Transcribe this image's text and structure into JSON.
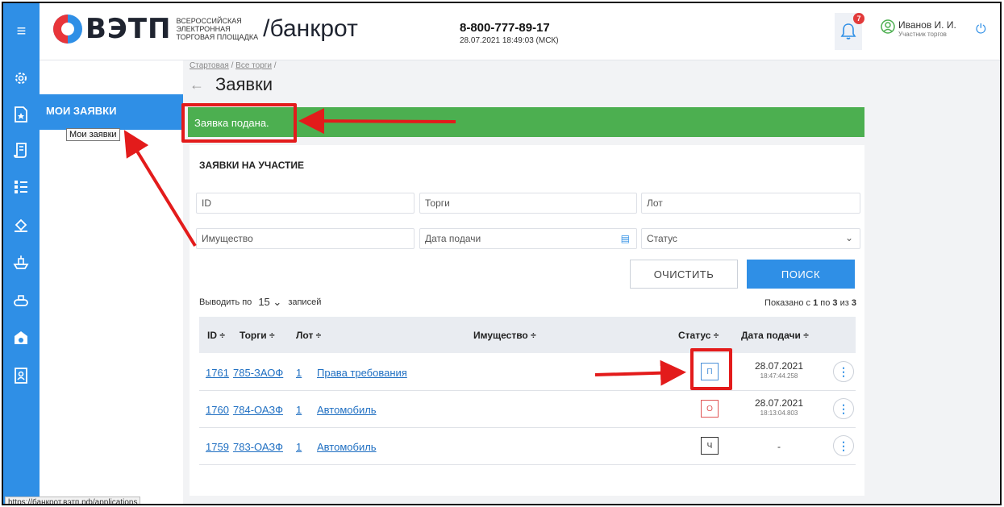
{
  "header": {
    "logo_text": "ВЭТП",
    "logo_sub_line1": "Всероссийская",
    "logo_sub_line2": "электронная",
    "logo_sub_line3": "торговая площадка",
    "logo_suffix": "/банкрот",
    "phone": "8-800-777-89-17",
    "datetime": "28.07.2021 18:49:03 (МСК)",
    "notifications_count": "7",
    "user_name": "Иванов И. И.",
    "user_role": "Участник торгов"
  },
  "subnav": {
    "active_item": "МОИ ЗАЯВКИ",
    "tooltip": "Мои заявки"
  },
  "breadcrumb": {
    "item1": "Стартовая",
    "sep": "/",
    "item2": "Все торги"
  },
  "page": {
    "title": "Заявки"
  },
  "alert": {
    "message": "Заявка подана."
  },
  "form": {
    "title": "ЗАЯВКИ НА УЧАСТИЕ",
    "id_placeholder": "ID",
    "trades_placeholder": "Торги",
    "lot_placeholder": "Лот",
    "property_placeholder": "Имущество",
    "date_placeholder": "Дата подачи",
    "status_placeholder": "Статус",
    "clear_label": "ОЧИСТИТЬ",
    "search_label": "ПОИСК"
  },
  "pagination": {
    "prefix": "Выводить по",
    "per_page": "15",
    "suffix": "записей",
    "shown_prefix": "Показано с",
    "from": "1",
    "to_word": "по",
    "to": "3",
    "of_word": "из",
    "total": "3"
  },
  "table": {
    "headers": {
      "id": "ID",
      "trades": "Торги",
      "lot": "Лот",
      "property": "Имущество",
      "status": "Статус",
      "date": "Дата подачи"
    },
    "rows": [
      {
        "id": "1761",
        "trade": "785-ЗАОФ",
        "lot": "1",
        "property": "Права требования",
        "status": "П",
        "status_color": "#4a90d9",
        "date": "28.07.2021",
        "time": "18:47:44.258"
      },
      {
        "id": "1760",
        "trade": "784-ОАЗФ",
        "lot": "1",
        "property": "Автомобиль",
        "status": "О",
        "status_color": "#e05555",
        "date": "28.07.2021",
        "time": "18:13:04.803"
      },
      {
        "id": "1759",
        "trade": "783-ОАЗФ",
        "lot": "1",
        "property": "Автомобиль",
        "status": "Ч",
        "status_color": "#333333",
        "date": "-",
        "time": ""
      }
    ]
  },
  "status_url": "https://банкрот.вэтп.рф/applications",
  "colors": {
    "primary": "#2f8fe6",
    "success": "#4caf50",
    "annotation": "#e31b1b"
  }
}
